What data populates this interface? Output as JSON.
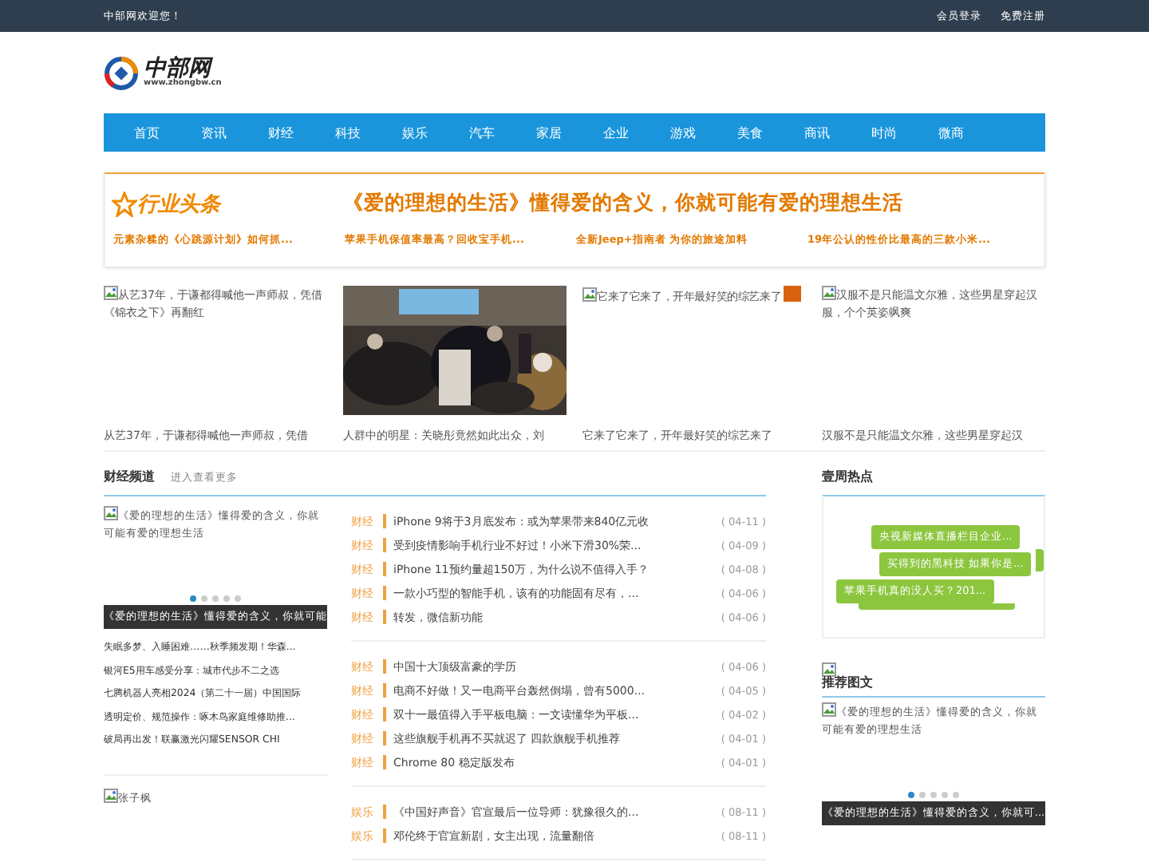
{
  "topbar": {
    "welcome": "中部网欢迎您！",
    "links": [
      "会员登录",
      "免费注册"
    ]
  },
  "logo": {
    "name": "中部网",
    "url": "www.zhongbw.cn"
  },
  "nav": [
    "首页",
    "资讯",
    "财经",
    "科技",
    "娱乐",
    "汽车",
    "家居",
    "企业",
    "游戏",
    "美食",
    "商讯",
    "时尚",
    "微商"
  ],
  "headline": {
    "badge": "行业头条",
    "title": "《爱的理想的生活》懂得爱的含义，你就可能有爱的理想生活",
    "links": [
      "元素杂糅的《心跳源计划》如何抓...",
      "苹果手机保值率最高？回收宝手机...",
      "全新Jeep+指南者 为你的旅途加料",
      "19年公认的性价比最高的三款小米..."
    ]
  },
  "gallery": [
    {
      "kind": "broken",
      "alt": "从艺37年，于谦都得喊他一声师叔，凭借《锦衣之下》再翻红",
      "caption": "从艺37年，于谦都得喊他一声师叔，凭借"
    },
    {
      "kind": "picture",
      "caption": "人群中的明星：关晓彤竟然如此出众，刘"
    },
    {
      "kind": "broken",
      "alt": "它来了它来了，开年最好笑的综艺来了",
      "caption": "它来了它来了，开年最好笑的综艺来了",
      "tag": true
    },
    {
      "kind": "broken",
      "alt": "汉服不是只能温文尔雅，这些男星穿起汉服，个个英姿飒爽",
      "caption": "汉服不是只能温文尔雅，这些男星穿起汉"
    }
  ],
  "finance": {
    "title": "财经频道",
    "more": "进入查看更多",
    "slider": {
      "alt": "《爱的理想的生活》懂得爱的含义，你就可能有爱的理想生活",
      "dots": [
        {
          "selected": true
        },
        {
          "selected": false
        },
        {
          "selected": false
        },
        {
          "selected": false
        },
        {
          "selected": false
        }
      ],
      "caption": "《爱的理想的生活》懂得爱的含义，你就可能"
    },
    "side_list": [
      "失眠多梦、入睡困难……秋季频发期！华森...",
      "银河E5用车感受分享：城市代步不二之选",
      "七腾机器人亮相2024（第二十一届）中国国际",
      "透明定价、规范操作：啄木鸟家庭维修助推...",
      "破局再出发！联赢激光闪耀SENSOR CHI"
    ],
    "groups": [
      [
        {
          "cat": "财经",
          "title": "iPhone 9将于3月底发布：或为苹果带来840亿元收",
          "date": "( 04-11 )"
        },
        {
          "cat": "财经",
          "title": "受到疫情影响手机行业不好过！小米下滑30%荣...",
          "date": "( 04-09 )"
        },
        {
          "cat": "财经",
          "title": "iPhone 11预约量超150万，为什么说不值得入手？",
          "date": "( 04-08 )"
        },
        {
          "cat": "财经",
          "title": "一款小巧型的智能手机，该有的功能固有尽有，...",
          "date": "( 04-06 )"
        },
        {
          "cat": "财经",
          "title": "转发，微信新功能",
          "date": "( 04-06 )"
        }
      ],
      [
        {
          "cat": "财经",
          "title": "中国十大顶级富豪的学历",
          "date": "( 04-06 )"
        },
        {
          "cat": "财经",
          "title": "电商不好做！又一电商平台轰然倒塌，曾有5000...",
          "date": "( 04-05 )"
        },
        {
          "cat": "财经",
          "title": "双十一最值得入手平板电脑：一文读懂华为平板...",
          "date": "( 04-02 )"
        },
        {
          "cat": "财经",
          "title": "这些旗舰手机再不买就迟了 四款旗舰手机推荐",
          "date": "( 04-01 )"
        },
        {
          "cat": "财经",
          "title": "Chrome 80 稳定版发布",
          "date": "( 04-01 )"
        }
      ],
      [
        {
          "cat": "娱乐",
          "title": "《中国好声音》官宣最后一位导师：犹豫很久的...",
          "date": "( 08-11 )"
        },
        {
          "cat": "娱乐",
          "title": "邓伦终于官宣新剧，女主出现，流量翻倍",
          "date": "( 08-11 )"
        }
      ]
    ],
    "bottom_alt": "张子枫"
  },
  "weekly": {
    "title": "壹周热点",
    "tags": [
      "央视新媒体直播栏目企业...",
      "买得到的黑科技 如果你是...",
      "苹果手机真的没人买？201..."
    ]
  },
  "recommend": {
    "title": "推荐图文",
    "alt": "《爱的理想的生活》懂得爱的含义，你就可能有爱的理想生活",
    "dots": [
      {
        "selected": true
      },
      {
        "selected": false
      },
      {
        "selected": false
      },
      {
        "selected": false
      },
      {
        "selected": false
      }
    ],
    "caption": "《爱的理想的生活》懂得爱的含义，你就可..."
  }
}
